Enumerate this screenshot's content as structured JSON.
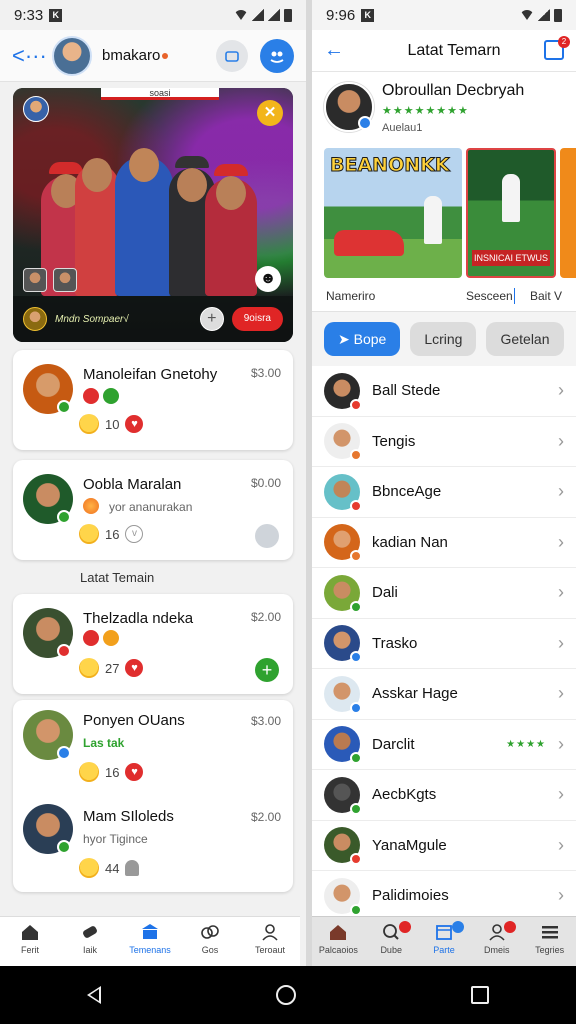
{
  "left": {
    "status": {
      "time": "9:33",
      "k": "K"
    },
    "header": {
      "username": "bmakaro",
      "back_icon": "back-dots-icon"
    },
    "hero": {
      "tag": "soasi",
      "caption": "Mndn Sompaer√",
      "button": "9oisra"
    },
    "cards": [
      {
        "name": "Manoleifan Gnetohy",
        "price": "$3.00",
        "count": "10"
      },
      {
        "name": "Oobla Maralan",
        "price": "$0.00",
        "sub": "yor ananurakan",
        "count": "16"
      }
    ],
    "section_title": "Latat Temain",
    "cards2": [
      {
        "name": "Thelzadla ndeka",
        "price": "$2.00",
        "count": "27"
      }
    ],
    "cards3": [
      {
        "name": "Ponyen OUans",
        "price": "$3.00",
        "sub": "Las tak",
        "count": "16"
      },
      {
        "name": "Mam SIloleds",
        "price": "$2.00",
        "sub": "hyor Tigince",
        "count": "44"
      }
    ],
    "nav": [
      {
        "label": "Ferit",
        "icon": "home-icon"
      },
      {
        "label": "Iaik",
        "icon": "tag-icon"
      },
      {
        "label": "Temenans",
        "icon": "bank-icon"
      },
      {
        "label": "Gos",
        "icon": "cloud-icon"
      },
      {
        "label": "Teroaut",
        "icon": "person-icon"
      }
    ]
  },
  "right": {
    "status": {
      "time": "9:96",
      "k": "K"
    },
    "header": {
      "title": "Latat Temarn",
      "bell_count": "2"
    },
    "profile": {
      "name": "Obroullan Decbryah",
      "stars": "★★★★★★★★",
      "sub": "Auelau1"
    },
    "gallery": {
      "poster_text": "BEANONKK",
      "overlay_text": "INSNICAI ETWUS"
    },
    "meta": {
      "left": "Nameriro",
      "middle": "Sesceen",
      "right": "Bait V"
    },
    "chips": [
      "Bope",
      "Lcring",
      "Getelan"
    ],
    "friends": [
      {
        "name": "Ball Stede",
        "badge": "#e63b2e"
      },
      {
        "name": "Tengis",
        "badge": "#e6772e"
      },
      {
        "name": "BbnceAge",
        "badge": "#e63b2e"
      },
      {
        "name": "kadian Nan",
        "badge": "#e6772e"
      },
      {
        "name": "Dali",
        "badge": "#2fa22f"
      },
      {
        "name": "Trasko",
        "badge": "#2a7fe7"
      },
      {
        "name": "Asskar Hage",
        "badge": "#2a7fe7"
      },
      {
        "name": "Darclit",
        "badge": "#2fa22f",
        "stars": "★★★★"
      },
      {
        "name": "AecbKgts",
        "badge": "#2fa22f"
      },
      {
        "name": "YanaMgule",
        "badge": "#e63b2e"
      },
      {
        "name": "Palidimoies",
        "badge": "#2fa22f"
      }
    ],
    "nav": [
      {
        "label": "Palcaoios",
        "icon": "house-icon"
      },
      {
        "label": "Dube",
        "icon": "search-icon"
      },
      {
        "label": "Parte",
        "icon": "calendar-icon"
      },
      {
        "label": "Dmeis",
        "icon": "people-icon"
      },
      {
        "label": "Tegries",
        "icon": "menu-icon"
      }
    ]
  },
  "colors": {
    "accent": "#2a7fe7",
    "danger": "#e02525",
    "success": "#2fa22f"
  }
}
